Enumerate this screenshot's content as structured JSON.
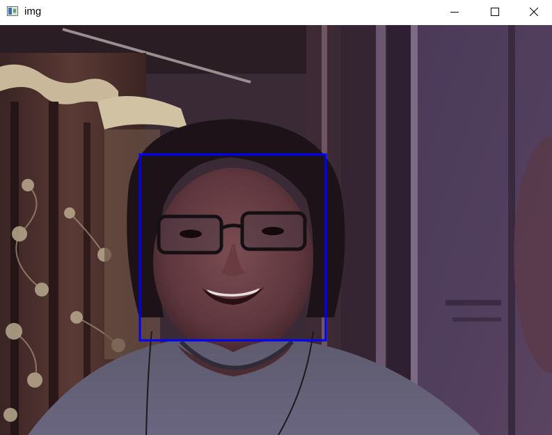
{
  "window": {
    "title": "img",
    "icon": "image-window-icon",
    "controls": {
      "minimize": "minimize-icon",
      "maximize": "maximize-icon",
      "close": "close-icon"
    }
  },
  "image": {
    "description_free": true,
    "detection_box_color": "#0000ff"
  }
}
